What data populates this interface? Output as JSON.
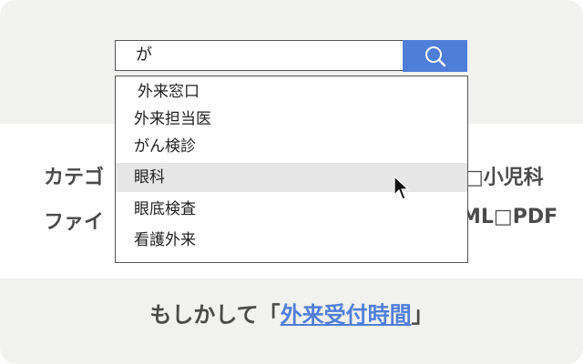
{
  "search": {
    "value": "が"
  },
  "filters": {
    "row1_left": "カテゴ",
    "row1_right": "□小児科",
    "row2_left": "ファイ",
    "row2_right": "ML□PDF"
  },
  "dropdown": {
    "items": [
      "外来窓口",
      "外来担当医",
      "がん検診",
      "眼科",
      "眼底検査",
      "看護外来"
    ],
    "highlighted_index": 3
  },
  "suggestion": {
    "prefix": "もしかして「",
    "link": "外来受付時間",
    "suffix": "」"
  },
  "colors": {
    "accent": "#4f7ed9",
    "band": "#f1f1f0",
    "highlight": "#e6e6e6"
  },
  "icons": {
    "search_button": "search-icon",
    "pointer": "mouse-pointer-icon"
  }
}
